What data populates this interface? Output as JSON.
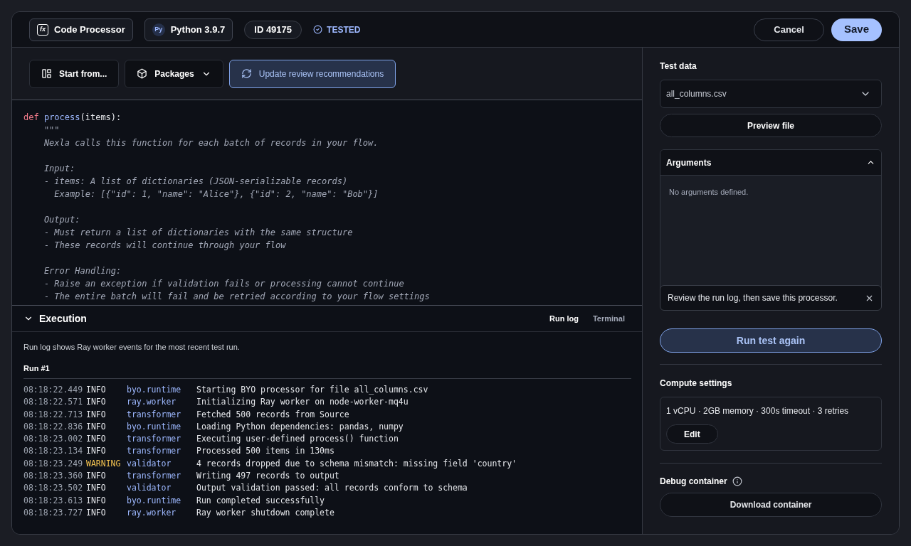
{
  "header": {
    "processor_icon": "fx",
    "processor": "Code Processor",
    "runtime_badge": "Py",
    "runtime": "Python 3.9.7",
    "id": "ID 49175",
    "status": "TESTED",
    "buttons": [
      {
        "label": "Cancel",
        "kind": "secondary"
      },
      {
        "label": "Save",
        "kind": "primary"
      }
    ]
  },
  "toolbar": [
    {
      "label": "Start from...",
      "kind": "template"
    },
    {
      "label": "Packages",
      "kind": "menu"
    },
    {
      "label": "Update review recommendations",
      "kind": "highlight"
    }
  ],
  "code": {
    "lines": [
      {
        "kind": "signature",
        "keyword": "def",
        "name": "process",
        "rest": "(items):"
      },
      {
        "kind": "comment",
        "text": "    \"\"\""
      },
      {
        "kind": "comment",
        "text": "    Nexla calls this function for each batch of records in your flow."
      },
      {
        "kind": "blank"
      },
      {
        "kind": "comment",
        "text": "    Input:"
      },
      {
        "kind": "comment",
        "text": "    - items: A list of dictionaries (JSON-serializable records)"
      },
      {
        "kind": "comment",
        "text": "      Example: [{\"id\": 1, \"name\": \"Alice\"}, {\"id\": 2, \"name\": \"Bob\"}]"
      },
      {
        "kind": "blank"
      },
      {
        "kind": "comment",
        "text": "    Output:"
      },
      {
        "kind": "comment",
        "text": "    - Must return a list of dictionaries with the same structure"
      },
      {
        "kind": "comment",
        "text": "    - These records will continue through your flow"
      },
      {
        "kind": "blank"
      },
      {
        "kind": "comment",
        "text": "    Error Handling:"
      },
      {
        "kind": "comment",
        "text": "    - Raise an exception if validation fails or processing cannot continue"
      },
      {
        "kind": "comment",
        "text": "    - The entire batch will fail and be retried according to your flow settings"
      }
    ]
  },
  "execution": {
    "title": "Execution",
    "expanded": true,
    "tabs": [
      {
        "label": "Run log",
        "selected": true
      },
      {
        "label": "Terminal",
        "selected": false
      }
    ],
    "description": "Run log shows Ray worker events for the most recent test run.",
    "run_title": "Run #1",
    "rows": [
      {
        "time": "08:18:22.449",
        "level": "INFO",
        "kind": "info",
        "source": "byo.runtime",
        "message": "Starting BYO processor for file all_columns.csv"
      },
      {
        "time": "08:18:22.571",
        "level": "INFO",
        "kind": "info",
        "source": "ray.worker",
        "message": "Initializing Ray worker on node-worker-mq4u"
      },
      {
        "time": "08:18:22.713",
        "level": "INFO",
        "kind": "info",
        "source": "transformer",
        "message": "Fetched 500 records from Source"
      },
      {
        "time": "08:18:22.836",
        "level": "INFO",
        "kind": "info",
        "source": "byo.runtime",
        "message": "Loading Python dependencies: pandas, numpy"
      },
      {
        "time": "08:18:23.002",
        "level": "INFO",
        "kind": "info",
        "source": "transformer",
        "message": "Executing user-defined process() function"
      },
      {
        "time": "08:18:23.134",
        "level": "INFO",
        "kind": "info",
        "source": "transformer",
        "message": "Processed 500 items in 130ms"
      },
      {
        "time": "08:18:23.249",
        "level": "WARNING",
        "kind": "warning",
        "source": "validator",
        "message": "4 records dropped due to schema mismatch: missing field 'country'"
      },
      {
        "time": "08:18:23.360",
        "level": "INFO",
        "kind": "info",
        "source": "transformer",
        "message": "Writing 497 records to output"
      },
      {
        "time": "08:18:23.502",
        "level": "INFO",
        "kind": "info",
        "source": "validator",
        "message": "Output validation passed: all records conform to schema"
      },
      {
        "time": "08:18:23.613",
        "level": "INFO",
        "kind": "info",
        "source": "byo.runtime",
        "message": "Run completed successfully"
      },
      {
        "time": "08:18:23.727",
        "level": "INFO",
        "kind": "info",
        "source": "ray.worker",
        "message": "Ray worker shutdown complete"
      }
    ]
  },
  "sidebar": {
    "test_data": {
      "title": "Test data",
      "value": "all_columns.csv",
      "preview": "Preview file"
    },
    "arguments": {
      "title": "Arguments",
      "expanded": true,
      "empty": "No arguments defined."
    },
    "tip": {
      "text": "Review the run log, then save this processor."
    },
    "run_button": "Run test again",
    "compute": {
      "title": "Compute settings",
      "summary": "1 vCPU · 2GB memory · 300s timeout · 3 retries",
      "edit": "Edit"
    },
    "debug": {
      "title": "Debug container",
      "download": "Download container"
    }
  }
}
